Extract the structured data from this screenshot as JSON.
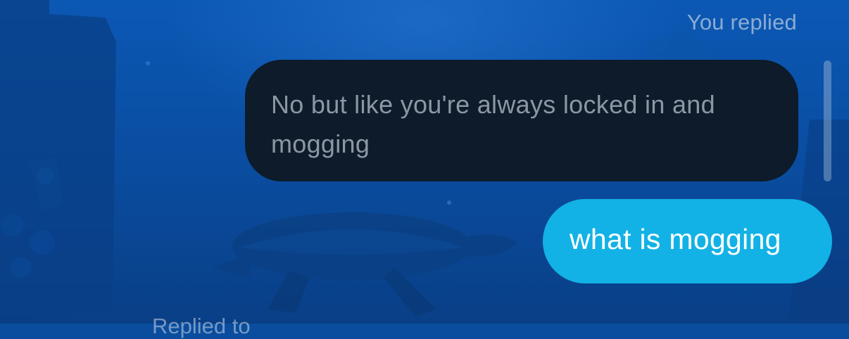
{
  "thread": {
    "header_label": "You replied",
    "messages": [
      {
        "sender": "other",
        "text": "No but like you're always locked in and mogging"
      },
      {
        "sender": "me",
        "text": "what is mogging"
      }
    ],
    "next_label_partial": "Replied to"
  },
  "colors": {
    "incoming_bubble": "#0d1b2a",
    "incoming_text": "#8d97a4",
    "outgoing_bubble": "#12b2e6",
    "outgoing_text": "#ffffff",
    "background": "#0a4d9e"
  },
  "icons": [
    "wallpaper-turtle-image"
  ]
}
